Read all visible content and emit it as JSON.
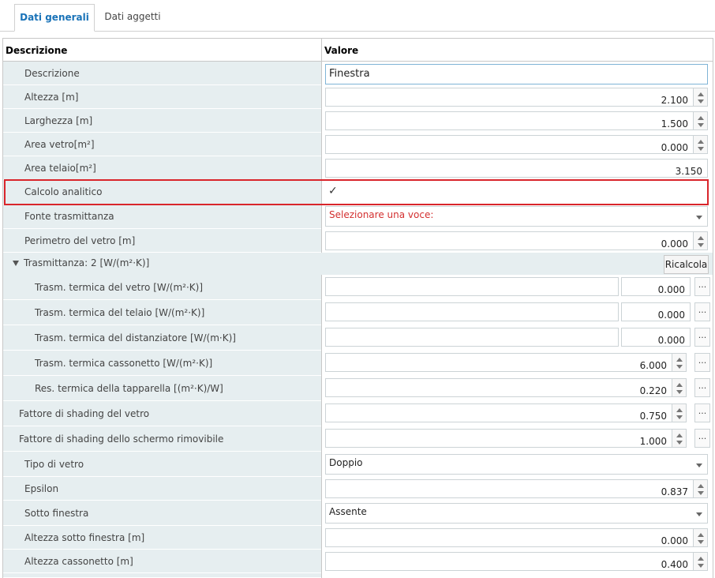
{
  "tabs": [
    {
      "label": "Dati generali",
      "active": true
    },
    {
      "label": "Dati aggetti",
      "active": false
    }
  ],
  "header": {
    "col_description": "Descrizione",
    "col_value": "Valore"
  },
  "rows": {
    "descrizione": {
      "label": "Descrizione",
      "value": "Finestra"
    },
    "altezza": {
      "label": "Altezza [m]",
      "value": "2.100"
    },
    "larghezza": {
      "label": "Larghezza [m]",
      "value": "1.500"
    },
    "area_vetro": {
      "label": "Area vetro[m²]",
      "value": "0.000"
    },
    "area_telaio": {
      "label": "Area telaio[m²]",
      "value": "3.150"
    },
    "calcolo_analitico": {
      "label": "Calcolo analitico",
      "checked": true,
      "check_glyph": "✓"
    },
    "fonte_trasmittanza": {
      "label": "Fonte trasmittanza",
      "value": "Selezionare una voce:"
    },
    "perimetro_vetro": {
      "label": "Perimetro del vetro [m]",
      "value": "0.000"
    },
    "trasmittanza_group": {
      "label": "Trasmittanza: 2 [W/(m²·K)]",
      "button": "Ricalcola"
    },
    "trasm_vetro": {
      "label": "Trasm. termica del vetro [W/(m²·K)]",
      "value": "0.000"
    },
    "trasm_telaio": {
      "label": "Trasm. termica del telaio [W/(m²·K)]",
      "value": "0.000"
    },
    "trasm_distanziatore": {
      "label": "Trasm. termica del distanziatore [W/(m·K)]",
      "value": "0.000"
    },
    "trasm_cassonetto": {
      "label": "Trasm. termica cassonetto [W/(m²·K)]",
      "value": "6.000"
    },
    "res_tapparella": {
      "label": "Res. termica della tapparella [(m²·K)/W]",
      "value": "0.220"
    },
    "shading_vetro": {
      "label": "Fattore di shading del vetro",
      "value": "0.750"
    },
    "shading_schermo": {
      "label": "Fattore di shading dello schermo rimovibile",
      "value": "1.000"
    },
    "tipo_vetro": {
      "label": "Tipo di vetro",
      "value": "Doppio"
    },
    "epsilon": {
      "label": "Epsilon",
      "value": "0.837"
    },
    "sotto_finestra": {
      "label": "Sotto finestra",
      "value": "Assente"
    },
    "altezza_sotto_finestra": {
      "label": "Altezza sotto finestra [m]",
      "value": "0.000"
    },
    "altezza_cassonetto": {
      "label": "Altezza cassonetto [m]",
      "value": "0.400"
    }
  },
  "ellipsis": "...",
  "colors": {
    "accent": "#1a73b8",
    "highlight": "#d9252b",
    "label_bg": "#e6eef0",
    "error_text": "#d32f2f"
  }
}
